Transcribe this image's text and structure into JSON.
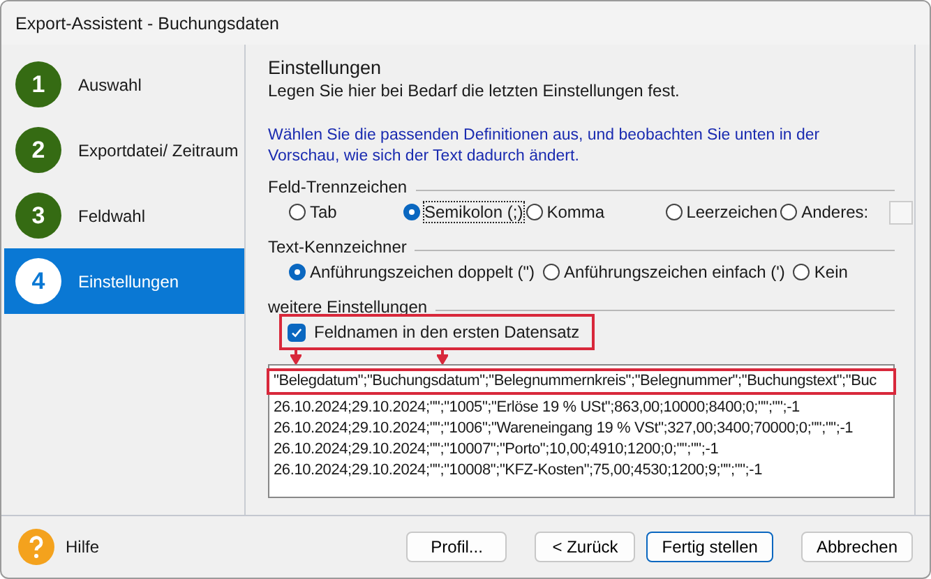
{
  "window": {
    "title": "Export-Assistent - Buchungsdaten"
  },
  "steps": [
    {
      "number": "1",
      "label": "Auswahl",
      "selected": false
    },
    {
      "number": "2",
      "label": "Exportdatei/ Zeitraum",
      "selected": false
    },
    {
      "number": "3",
      "label": "Feldwahl",
      "selected": false
    },
    {
      "number": "4",
      "label": "Einstellungen",
      "selected": true
    }
  ],
  "header": {
    "title": "Einstellungen",
    "subtitle": "Legen Sie hier bei Bedarf die letzten Einstellungen fest."
  },
  "info": "Wählen Sie die passenden Definitionen aus, und beobachten Sie unten in der Vorschau, wie sich der Text dadurch ändert.",
  "field_separator": {
    "label": "Feld-Trennzeichen",
    "options": [
      {
        "label": "Tab",
        "selected": false,
        "focused": false
      },
      {
        "label": "Semikolon (;)",
        "selected": true,
        "focused": true
      },
      {
        "label": "Komma",
        "selected": false,
        "focused": false
      },
      {
        "label": "Leerzeichen",
        "selected": false,
        "focused": false
      },
      {
        "label": "Anderes:",
        "selected": false,
        "focused": false
      }
    ]
  },
  "text_qualifier": {
    "label": "Text-Kennzeichner",
    "options": [
      {
        "label": "Anführungszeichen doppelt (\")",
        "selected": true,
        "focused": false
      },
      {
        "label": "Anführungszeichen einfach (')",
        "selected": false,
        "focused": false
      },
      {
        "label": "Kein",
        "selected": false,
        "focused": false
      }
    ]
  },
  "further": {
    "label": "weitere Einstellungen",
    "checkbox": {
      "label": "Feldnamen in den ersten Datensatz",
      "checked": true
    }
  },
  "preview": {
    "lines": [
      "\"Belegdatum\";\"Buchungsdatum\";\"Belegnummernkreis\";\"Belegnummer\";\"Buchungstext\";\"Buc",
      "26.10.2024;29.10.2024;\"\";\"1005\";\"Erlöse 19 % USt\";863,00;10000;8400;0;\"\";\"\";-1",
      "26.10.2024;29.10.2024;\"\";\"1006\";\"Wareneingang 19 % VSt\";327,00;3400;70000;0;\"\";\"\";-1",
      "26.10.2024;29.10.2024;\"\";\"10007\";\"Porto\";10,00;4910;1200;0;\"\";\"\";-1",
      "26.10.2024;29.10.2024;\"\";\"10008\";\"KFZ-Kosten\";75,00;4530;1200;9;\"\";\"\";-1"
    ]
  },
  "footer": {
    "help": "Hilfe",
    "buttons": [
      {
        "label": "Profil...",
        "default": false
      },
      {
        "label": "< Zurück",
        "default": false
      },
      {
        "label": "Fertig stellen",
        "default": true
      },
      {
        "label": "Abbrechen",
        "default": false
      }
    ]
  }
}
